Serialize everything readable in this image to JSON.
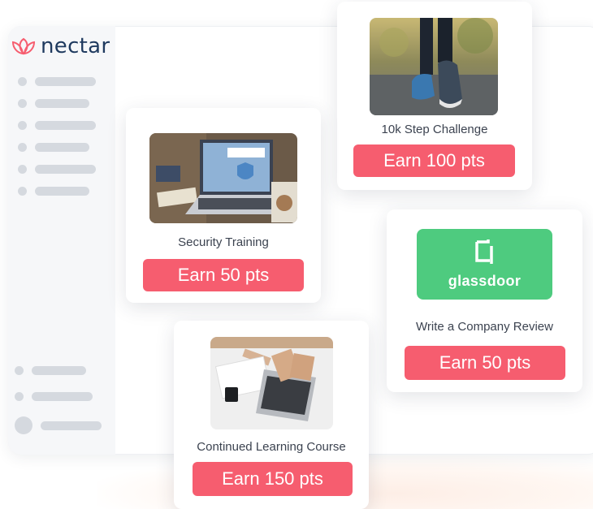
{
  "app": {
    "brand": "nectar",
    "accent_color": "#f65d6f",
    "logo_icon": "lotus-icon"
  },
  "cards": {
    "step_challenge": {
      "title": "10k Step Challenge",
      "button": "Earn 100 pts",
      "image": "walking-shoes-photo"
    },
    "security_training": {
      "title": "Security Training",
      "button": "Earn 50 pts",
      "image": "cyber-security-laptop-photo"
    },
    "company_review": {
      "title": "Write a Company Review",
      "button": "Earn 50 pts",
      "logo_text": "glassdoor",
      "logo_color": "#4ecb7f"
    },
    "learning_course": {
      "title": "Continued Learning Course",
      "button": "Earn 150 pts",
      "image": "laptop-desk-photo"
    }
  }
}
